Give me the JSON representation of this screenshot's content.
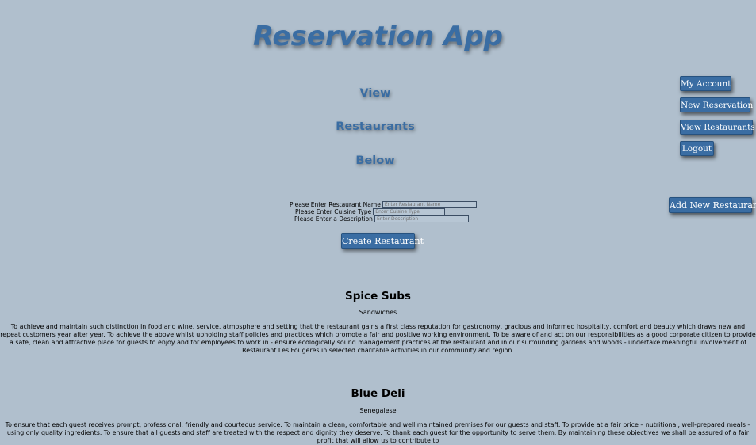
{
  "header": {
    "title": "Reservation App"
  },
  "view_heading": {
    "line1": "View",
    "line2": "Restaurants",
    "line3": "Below"
  },
  "nav": {
    "my_account": "My Account",
    "new_reservation": "New Reservation",
    "view_restaurants": "View Restaurants",
    "logout": "Logout",
    "add_new_restaurant": "Add New Restaurant"
  },
  "form": {
    "name_label": "Please Enter Restaurant Name",
    "name_placeholder": "Enter Restaurant Name",
    "cuisine_label": "Please Enter Cuisine Type",
    "cuisine_placeholder": "Enter Cuisine Type",
    "description_label": "Please Enter a Description",
    "description_placeholder": "Enter Description",
    "submit_label": "Create Restaurant"
  },
  "restaurants": [
    {
      "name": "Spice Subs",
      "cuisine": "Sandwiches",
      "description": "To achieve and maintain such distinction in food and wine, service, atmosphere and setting that the restaurant gains a first class reputation for gastronomy, gracious and informed hospitality, comfort and beauty which draws new and repeat customers year after year. To achieve the above whilst upholding staff policies and practices which promote a fair and positive working environment. To be aware of and act on our responsibilities as a good corporate citizen to provide a safe, clean and attractive place for guests to enjoy and for employees to work in - ensure ecologically sound management practices at the restaurant and in our surrounding gardens and woods - undertake meaningful involvement of Restaurant Les Fougeres in selected charitable activities in our community and region."
    },
    {
      "name": "Blue Deli",
      "cuisine": "Senegalese",
      "description": "To ensure that each guest receives prompt, professional, friendly and courteous service. To maintain a clean, comfortable and well maintained premises for our guests and staff. To provide at a fair price – nutritional, well-prepared meals – using only quality ingredients. To ensure that all guests and staff are treated with the respect and dignity they deserve. To thank each guest for the opportunity to serve them. By maintaining these objectives we shall be assured of a fair profit that will allow us to contribute to"
    }
  ]
}
